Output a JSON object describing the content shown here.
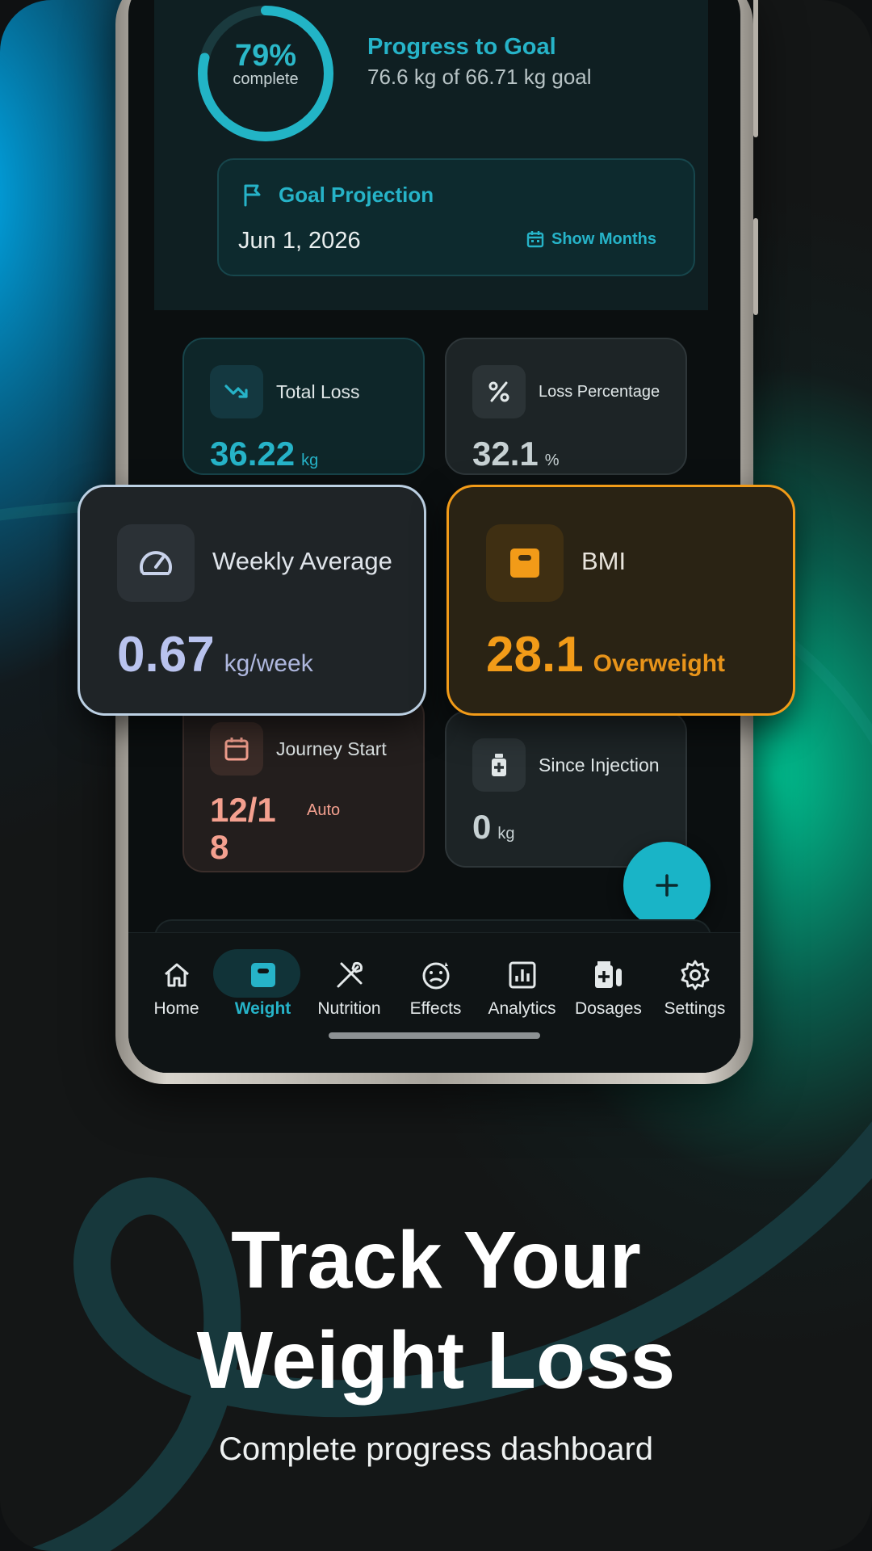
{
  "progress": {
    "percent_label": "79%",
    "percent_value": 79,
    "sub_label": "complete",
    "title": "Progress to Goal",
    "detail": "76.6 kg of 66.71 kg goal"
  },
  "projection": {
    "title": "Goal Projection",
    "date": "Jun 1, 2026",
    "button_label": "Show Months"
  },
  "cards": {
    "total_loss": {
      "label": "Total Loss",
      "value": "36.22",
      "unit": "kg",
      "icon": "trending-down-icon"
    },
    "loss_percentage": {
      "label": "Loss Percentage",
      "value": "32.1",
      "unit": "%",
      "icon": "percent-icon"
    },
    "weekly_average": {
      "label": "Weekly Average",
      "value": "0.67",
      "unit": "kg/week",
      "icon": "speedometer-icon"
    },
    "bmi": {
      "label": "BMI",
      "value": "28.1",
      "status": "Overweight",
      "icon": "scale-icon"
    },
    "journey_start": {
      "label": "Journey Start",
      "value_line1": "12/1",
      "value_line2": "8",
      "badge": "Auto",
      "icon": "calendar-icon"
    },
    "since_injection": {
      "label": "Since Injection",
      "value": "0",
      "unit": "kg",
      "icon": "medicine-icon"
    }
  },
  "nav": {
    "items": [
      {
        "label": "Home",
        "icon": "home-icon"
      },
      {
        "label": "Weight",
        "icon": "scale-icon",
        "active": true
      },
      {
        "label": "Nutrition",
        "icon": "utensils-icon"
      },
      {
        "label": "Effects",
        "icon": "face-icon"
      },
      {
        "label": "Analytics",
        "icon": "bar-chart-icon"
      },
      {
        "label": "Dosages",
        "icon": "pills-icon"
      },
      {
        "label": "Settings",
        "icon": "gear-icon"
      }
    ]
  },
  "marketing": {
    "headline_line1": "Track Your",
    "headline_line2": "Weight Loss",
    "subline": "Complete progress dashboard"
  },
  "colors": {
    "accent": "#26b3c8",
    "bmi": "#f29b18",
    "weekly": "#b9c3ee",
    "journey": "#f4a08f"
  }
}
